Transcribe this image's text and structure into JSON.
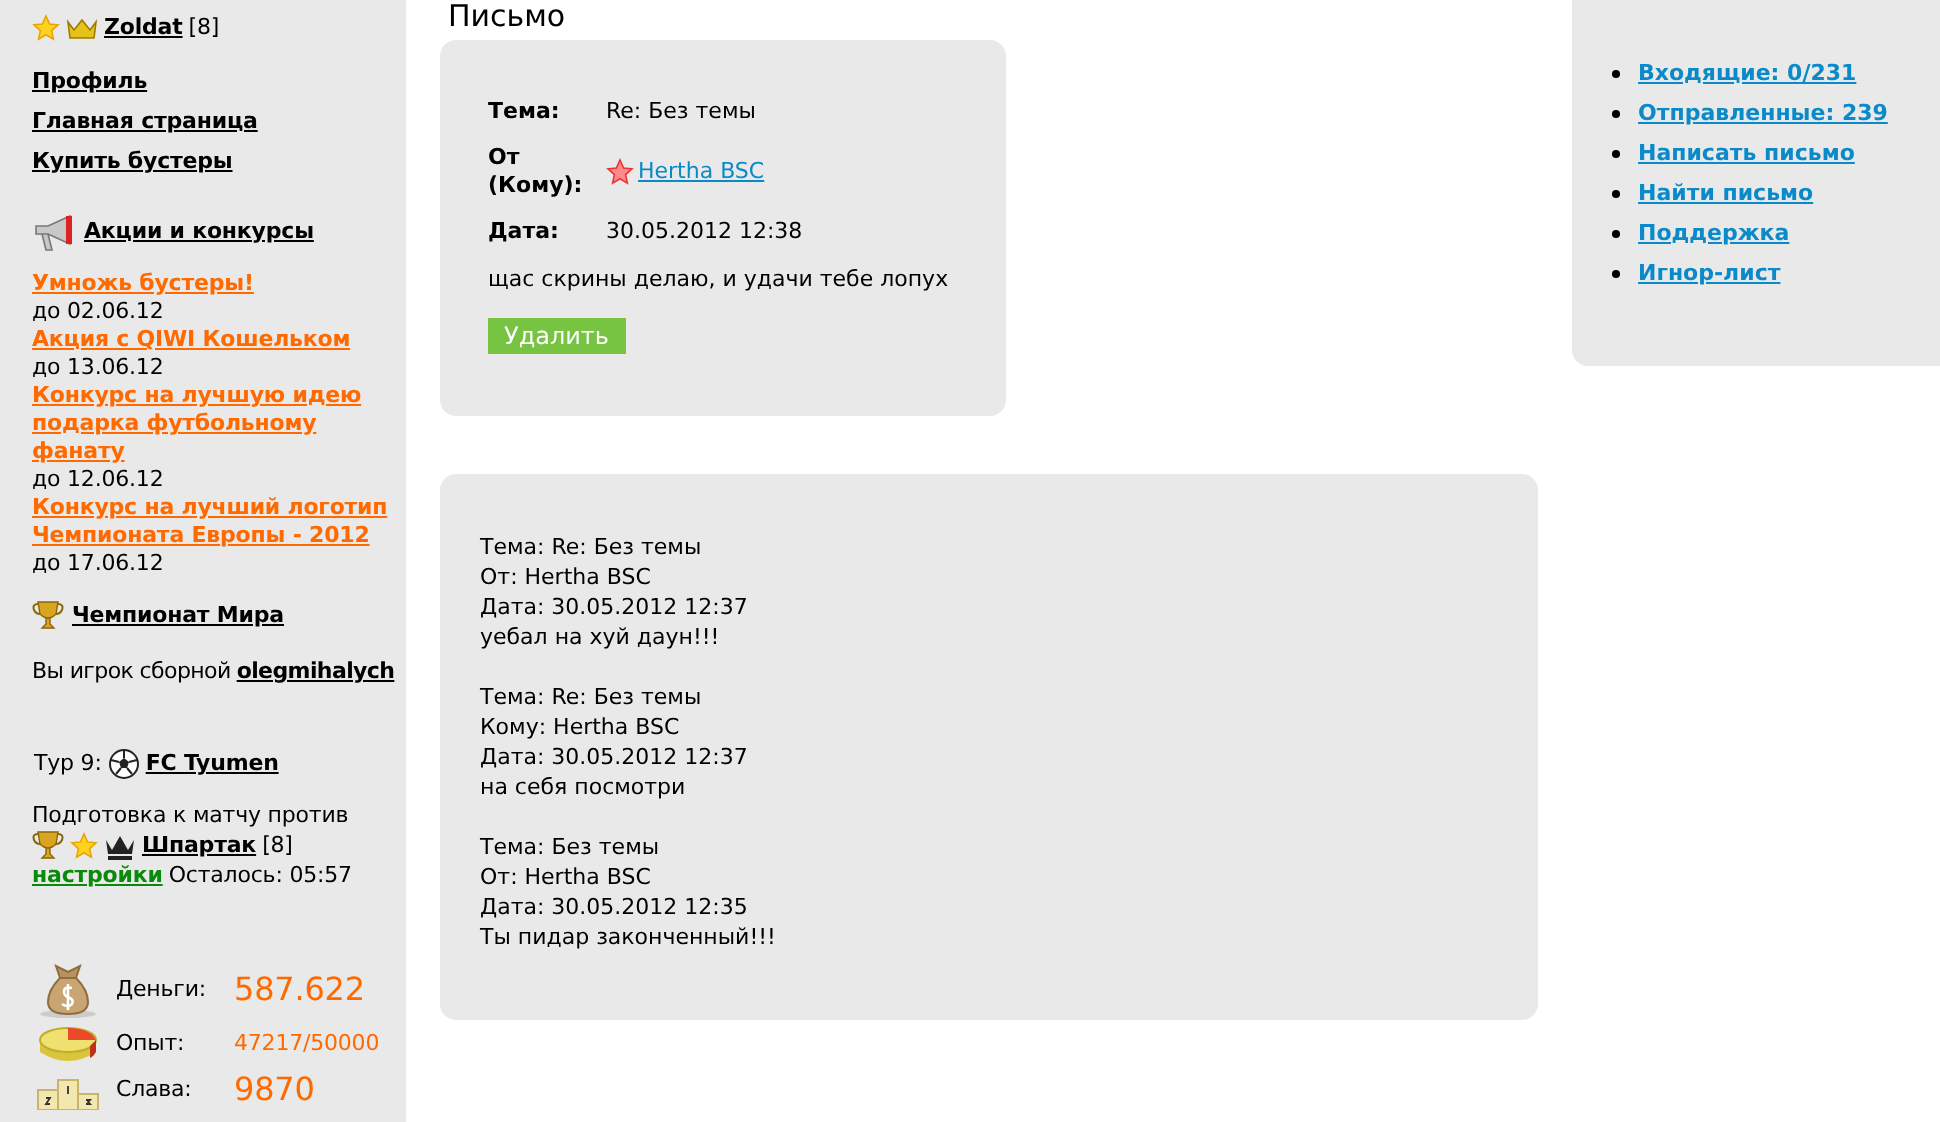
{
  "sidebar": {
    "user": {
      "name": "Zoldat",
      "level": "[8]"
    },
    "nav": [
      "Профиль",
      "Главная страница",
      "Купить бустеры"
    ],
    "promos": {
      "title": "Акции и конкурсы",
      "items": [
        {
          "link": "Умножь бустеры!",
          "until": "до 02.06.12"
        },
        {
          "link": "Акция с QIWI Кошельком",
          "until": "до 13.06.12"
        },
        {
          "link": "Конкурс на лучшую идею подарка футбольному фанату",
          "until": "до 12.06.12"
        },
        {
          "link": "Конкурс на лучший логотип Чемпионата Европы - 2012",
          "until": "до 17.06.12"
        }
      ]
    },
    "championship": {
      "title": "Чемпионат Мира",
      "team_text": "Вы игрок сборной",
      "team": "olegmihalych"
    },
    "tour": {
      "label": "Тур 9:",
      "club": "FC Tyumen"
    },
    "match": {
      "text": "Подготовка к матчу против",
      "opponent": "Шпартак",
      "level": "[8]",
      "settings": "настройки",
      "remaining": "Осталось: 05:57"
    },
    "stats": [
      {
        "kind": "money",
        "label": "Деньги:",
        "value": "587.622"
      },
      {
        "kind": "experience",
        "label": "Опыт:",
        "value": "47217/50000"
      },
      {
        "kind": "fame",
        "label": "Слава:",
        "value": "9870"
      }
    ]
  },
  "page_title": "Письмо",
  "letter": {
    "subject_label": "Тема:",
    "subject": "Re: Без темы",
    "from_label": "От (Кому):",
    "from": "Hertha BSC",
    "date_label": "Дата:",
    "date": "30.05.2012 12:38",
    "body": "щас скрины делаю, и удачи тебе лопух",
    "delete_button": "Удалить"
  },
  "quoted": [
    {
      "lines": [
        "Тема: Re: Без темы",
        "От: Hertha BSC",
        "Дата: 30.05.2012 12:37",
        "уебал на хуй даун!!!"
      ]
    },
    {
      "lines": [
        "Тема: Re: Без темы",
        "Кому: Hertha BSC",
        "Дата: 30.05.2012 12:37",
        "на себя посмотри"
      ]
    },
    {
      "lines": [
        "Тема: Без темы",
        "От: Hertha BSC",
        "Дата: 30.05.2012 12:35",
        "Ты пидар законченный!!!"
      ]
    }
  ],
  "mail_menu": [
    "Входящие: 0/231",
    "Отправленные: 239",
    "Написать письмо",
    "Найти письмо",
    "Поддержка",
    "Игнор-лист"
  ]
}
